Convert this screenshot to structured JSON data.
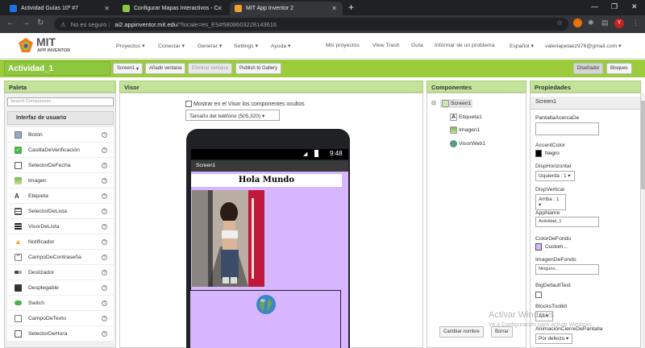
{
  "browser": {
    "tabs": [
      {
        "title": "Actividad Guías 10º #7"
      },
      {
        "title": "Configurar Mapas Interactivos - C"
      },
      {
        "title": "MIT App Inventor 2"
      }
    ],
    "security_label": "No es seguro",
    "url_host": "ai2.appinventor.mit.edu",
    "url_rest": "/?locale=es_ES#5808603228143616",
    "avatar_letter": "Y"
  },
  "app": {
    "logo_title": "MIT",
    "logo_subtitle": "APP INVENTOR",
    "menu": [
      "Proyectos",
      "Conectar",
      "Generar",
      "Settings",
      "Ayuda"
    ],
    "right_links": [
      "Mis proyectos",
      "View Trash",
      "Guía",
      "Informar de un problema",
      "Español",
      "valeriapelaez976@gmail.com"
    ]
  },
  "project": {
    "name": "Actividad_1",
    "screen_btn": "Screen1",
    "add_screen": "Añadir ventana",
    "remove_screen": "Eliminar ventana",
    "publish": "Publish to Gallery",
    "designer": "Diseñador",
    "blocks": "Bloques"
  },
  "palette": {
    "title": "Paleta",
    "search_placeholder": "Search Components...",
    "category": "Interfaz de usuario",
    "items": [
      "Botón",
      "CasillaDeVerificación",
      "SelectorDeFecha",
      "Imagen",
      "Etiqueta",
      "SelectorDeLista",
      "VisorDeLista",
      "Notificador",
      "CampoDeContraseña",
      "Deslizador",
      "Desplegable",
      "Switch",
      "CampoDeTexto",
      "SelectorDeHora"
    ]
  },
  "viewer": {
    "title": "Visor",
    "checkbox_label": "Mostrar en el Visor los componentes ocultos",
    "phone_size": "Tamaño del teléfono (505,320)",
    "clock": "9:48",
    "screen_title": "Screen1",
    "label_text": "Hola Mundo"
  },
  "components": {
    "title": "Componentes",
    "root": "Screen1",
    "children": [
      "Etiqueta1",
      "Imagen1",
      "VisorWeb1"
    ],
    "rename_btn": "Cambiar nombre",
    "delete_btn": "Borrar"
  },
  "properties": {
    "title": "Propiedades",
    "component": "Screen1",
    "about_label": "PantallaAcercaDe",
    "accent_label": "AccentColor",
    "accent_value": "Negro",
    "accent_color": "#000000",
    "halign_label": "DispHorizontal",
    "halign_value": "Izquierda : 1 ▾",
    "valign_label": "DispVertical",
    "valign_value": "Arriba : 1 ▾",
    "appname_label": "AppName",
    "appname_value": "Actividad_1",
    "bgcolor_label": "ColorDeFondo",
    "bgcolor_value": "Custom...",
    "bgcolor_color": "#d8b6ff",
    "bgimage_label": "ImagenDeFondo",
    "bgimage_value": "Ninguno...",
    "bigtext_label": "BigDefaultText",
    "toolkit_label": "BlocksToolkit",
    "toolkit_value": "All ▾",
    "anim_label": "AnimaciónCierreDePantalla",
    "anim_value": "Por defecto ▾"
  },
  "watermark": {
    "line1": "Activar Windows",
    "line2": "Ve a Configuración para activar Windows."
  }
}
